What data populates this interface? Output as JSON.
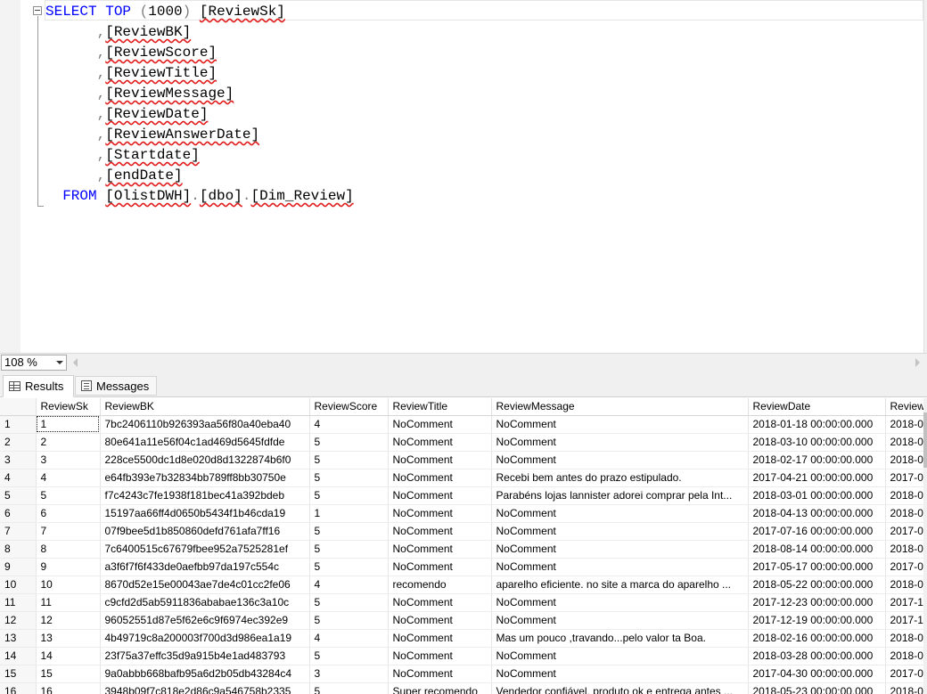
{
  "editor": {
    "lines": [
      [
        {
          "t": "SELECT",
          "c": "kw"
        },
        {
          "t": " "
        },
        {
          "t": "TOP",
          "c": "kw"
        },
        {
          "t": " "
        },
        {
          "t": "(",
          "c": "gr"
        },
        {
          "t": "1000"
        },
        {
          "t": ")",
          "c": "gr"
        },
        {
          "t": " "
        },
        {
          "t": "[ReviewSk]",
          "c": "id"
        }
      ],
      [
        {
          "t": "      "
        },
        {
          "t": ",",
          "c": "gr"
        },
        {
          "t": "[ReviewBK]",
          "c": "id"
        }
      ],
      [
        {
          "t": "      "
        },
        {
          "t": ",",
          "c": "gr"
        },
        {
          "t": "[ReviewScore]",
          "c": "id"
        }
      ],
      [
        {
          "t": "      "
        },
        {
          "t": ",",
          "c": "gr"
        },
        {
          "t": "[ReviewTitle]",
          "c": "id"
        }
      ],
      [
        {
          "t": "      "
        },
        {
          "t": ",",
          "c": "gr"
        },
        {
          "t": "[ReviewMessage]",
          "c": "id"
        }
      ],
      [
        {
          "t": "      "
        },
        {
          "t": ",",
          "c": "gr"
        },
        {
          "t": "[ReviewDate]",
          "c": "id"
        }
      ],
      [
        {
          "t": "      "
        },
        {
          "t": ",",
          "c": "gr"
        },
        {
          "t": "[ReviewAnswerDate]",
          "c": "id"
        }
      ],
      [
        {
          "t": "      "
        },
        {
          "t": ",",
          "c": "gr"
        },
        {
          "t": "[Startdate]",
          "c": "id"
        }
      ],
      [
        {
          "t": "      "
        },
        {
          "t": ",",
          "c": "gr"
        },
        {
          "t": "[endDate]",
          "c": "id"
        }
      ],
      [
        {
          "t": "  "
        },
        {
          "t": "FROM",
          "c": "kw"
        },
        {
          "t": " "
        },
        {
          "t": "[OlistDWH]",
          "c": "id"
        },
        {
          "t": ".",
          "c": "gr"
        },
        {
          "t": "[dbo]",
          "c": "id"
        },
        {
          "t": ".",
          "c": "gr"
        },
        {
          "t": "[Dim_Review]",
          "c": "id"
        }
      ]
    ]
  },
  "statusbar": {
    "zoom": "108 %"
  },
  "tabs": {
    "results": "Results",
    "messages": "Messages"
  },
  "grid": {
    "columns": [
      "",
      "ReviewSk",
      "ReviewBK",
      "ReviewScore",
      "ReviewTitle",
      "ReviewMessage",
      "ReviewDate",
      "Review"
    ],
    "rows": [
      [
        "1",
        "1",
        "7bc2406110b926393aa56f80a40eba40",
        "4",
        "NoComment",
        "NoComment",
        "2018-01-18 00:00:00.000",
        "2018-0"
      ],
      [
        "2",
        "2",
        "80e641a11e56f04c1ad469d5645fdfde",
        "5",
        "NoComment",
        "NoComment",
        "2018-03-10 00:00:00.000",
        "2018-0"
      ],
      [
        "3",
        "3",
        "228ce5500dc1d8e020d8d1322874b6f0",
        "5",
        "NoComment",
        "NoComment",
        "2018-02-17 00:00:00.000",
        "2018-0"
      ],
      [
        "4",
        "4",
        "e64fb393e7b32834bb789ff8bb30750e",
        "5",
        "NoComment",
        "Recebi bem antes do prazo estipulado.",
        "2017-04-21 00:00:00.000",
        "2017-0"
      ],
      [
        "5",
        "5",
        "f7c4243c7fe1938f181bec41a392bdeb",
        "5",
        "NoComment",
        "Parabéns lojas lannister adorei comprar pela Int...",
        "2018-03-01 00:00:00.000",
        "2018-0"
      ],
      [
        "6",
        "6",
        "15197aa66ff4d0650b5434f1b46cda19",
        "1",
        "NoComment",
        "NoComment",
        "2018-04-13 00:00:00.000",
        "2018-0"
      ],
      [
        "7",
        "7",
        "07f9bee5d1b850860defd761afa7ff16",
        "5",
        "NoComment",
        "NoComment",
        "2017-07-16 00:00:00.000",
        "2017-0"
      ],
      [
        "8",
        "8",
        "7c6400515c67679fbee952a7525281ef",
        "5",
        "NoComment",
        "NoComment",
        "2018-08-14 00:00:00.000",
        "2018-0"
      ],
      [
        "9",
        "9",
        "a3f6f7f6f433de0aefbb97da197c554c",
        "5",
        "NoComment",
        "NoComment",
        "2017-05-17 00:00:00.000",
        "2017-0"
      ],
      [
        "10",
        "10",
        "8670d52e15e00043ae7de4c01cc2fe06",
        "4",
        "recomendo",
        "aparelho eficiente. no site a marca do aparelho ...",
        "2018-05-22 00:00:00.000",
        "2018-0"
      ],
      [
        "11",
        "11",
        "c9cfd2d5ab5911836ababae136c3a10c",
        "5",
        "NoComment",
        "NoComment",
        "2017-12-23 00:00:00.000",
        "2017-1"
      ],
      [
        "12",
        "12",
        "96052551d87e5f62e6c9f6974ec392e9",
        "5",
        "NoComment",
        "NoComment",
        "2017-12-19 00:00:00.000",
        "2017-1"
      ],
      [
        "13",
        "13",
        "4b49719c8a200003f700d3d986ea1a19",
        "4",
        "NoComment",
        "Mas um pouco ,travando...pelo valor ta Boa.",
        "2018-02-16 00:00:00.000",
        "2018-0"
      ],
      [
        "14",
        "14",
        "23f75a37effc35d9a915b4e1ad483793",
        "5",
        "NoComment",
        "NoComment",
        "2018-03-28 00:00:00.000",
        "2018-0"
      ],
      [
        "15",
        "15",
        "9a0abbb668bafb95a6d2b05db43284c4",
        "3",
        "NoComment",
        "NoComment",
        "2017-04-30 00:00:00.000",
        "2017-0"
      ],
      [
        "16",
        "16",
        "3948b09f7c818e2d86c9a546758b2335",
        "5",
        "Super recomendo",
        "Vendedor confiável, produto ok e entrega antes ...",
        "2018-05-23 00:00:00.000",
        "2018-0"
      ]
    ]
  }
}
